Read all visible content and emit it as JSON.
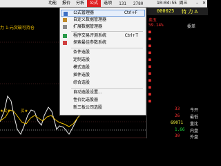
{
  "menubar": {
    "items": [
      "功能",
      "报价",
      "分析",
      "公式",
      "选项"
    ],
    "active_index": 3,
    "stats": [
      "131",
      "2780"
    ],
    "clock": "10:04:55 周三",
    "window_buttons": [
      "最小化",
      "关闭"
    ]
  },
  "chart": {
    "indicator_prefix": "力",
    "indicator_name": "1-元突破可持仓",
    "buy_label_1": "买★",
    "buy_label_2": "★买★"
  },
  "stock": {
    "code": "000025",
    "name": "特 力 A"
  },
  "panel": {
    "rows": [
      {
        "label": "卖五",
        "value": ""
      },
      {
        "label": "59.14%",
        "value": "委差"
      },
      {
        "label": "",
        "value": "委比"
      }
    ],
    "bottom": [
      {
        "label": "今开",
        "value": "33"
      },
      {
        "label": "最低",
        "value": "26"
      },
      {
        "label": "量比",
        "value": "69071"
      },
      {
        "label": "内盘",
        "value": "1.66"
      },
      {
        "label": "外盘",
        "value": "30"
      }
    ]
  },
  "dropdown": {
    "items": [
      {
        "label": "公式管理器",
        "shortcut": "Ctrl+F",
        "icon": "formula-icon",
        "highlighted": true
      },
      {
        "label": "自定义数据管理器",
        "shortcut": "",
        "icon": "data-icon"
      },
      {
        "label": "扩展数据管理器",
        "shortcut": "",
        "icon": "ext-data-icon"
      },
      {
        "label": "程序交易评测系统",
        "shortcut": "Ctrl+T",
        "icon": "eval-icon"
      },
      {
        "label": "探索最佳参数系统",
        "shortcut": "",
        "icon": "explore-icon"
      },
      {
        "label": "条件选股",
        "shortcut": "",
        "icon": "filter-icon"
      },
      {
        "label": "定制选股",
        "shortcut": "",
        "icon": "custom-icon"
      },
      {
        "label": "模式选股",
        "shortcut": "",
        "icon": "pattern-icon"
      },
      {
        "label": "插件选股",
        "shortcut": "",
        "icon": "plugin-icon"
      },
      {
        "label": "综合选股",
        "shortcut": "",
        "icon": "combo-icon"
      },
      {
        "label": "自动选股设置...",
        "shortcut": "",
        "icon": "auto-icon"
      },
      {
        "label": "性价比选股器",
        "shortcut": "",
        "icon": "value-icon"
      },
      {
        "label": "新三板公司选股",
        "shortcut": "",
        "icon": "neeq-icon"
      }
    ]
  },
  "colors": {
    "accent": "#e02020",
    "menu_bg": "#f3f3f3",
    "highlight": "#6f9ee0"
  }
}
